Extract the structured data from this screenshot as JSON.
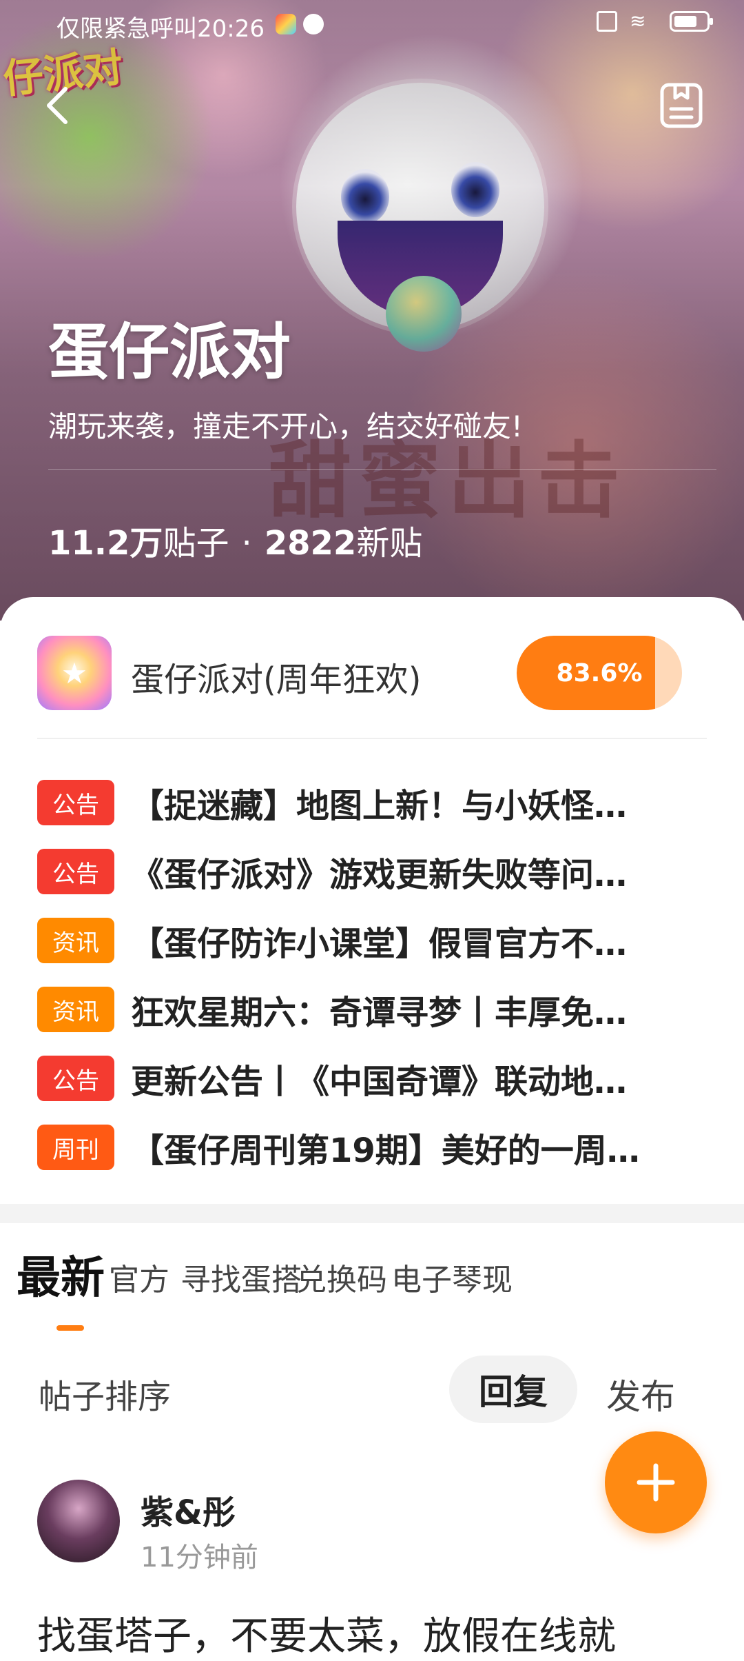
{
  "status_bar": {
    "carrier_text": "仅限紧急呼叫",
    "time": "20:26"
  },
  "forum": {
    "title": "蛋仔派对",
    "subtitle": "潮玩来袭，撞走不开心，结交好碰友!",
    "post_count": "11.2万",
    "post_count_label": "贴子",
    "separator": "·",
    "new_count": "2822",
    "new_count_label": "新贴"
  },
  "game": {
    "name": "蛋仔派对(周年狂欢)",
    "progress_label": "83.6%",
    "progress_fraction": 0.836
  },
  "notices": [
    {
      "tag": "公告",
      "text": "【捉迷藏】地图上新！与小妖怪…"
    },
    {
      "tag": "公告",
      "text": "《蛋仔派对》游戏更新失败等问…"
    },
    {
      "tag": "资讯",
      "text": "【蛋仔防诈小课堂】假冒官方不…"
    },
    {
      "tag": "资讯",
      "text": "狂欢星期六：奇谭寻梦丨丰厚免…"
    },
    {
      "tag": "公告",
      "text": "更新公告丨《中国奇谭》联动地…"
    },
    {
      "tag": "周刊",
      "text": "【蛋仔周刊第19期】美好的一周…"
    }
  ],
  "tabs": [
    "最新",
    "官方",
    "寻找蛋搭",
    "兑换码",
    "电子琴",
    "现"
  ],
  "sort": {
    "label": "帖子排序",
    "reply": "回复",
    "publish": "发布"
  },
  "post": {
    "user": "紫&彤",
    "time": "11分钟前",
    "body": "找蛋塔子，不要太菜，放假在线就"
  },
  "colors": {
    "accent": "#ff7d12",
    "tag_announcement": "#f43b30",
    "tag_news": "#ff8a00",
    "tag_weekly": "#ff5a14"
  },
  "icons": {
    "back": "chevron-left-icon",
    "doc": "document-icon",
    "fab": "plus-icon"
  }
}
